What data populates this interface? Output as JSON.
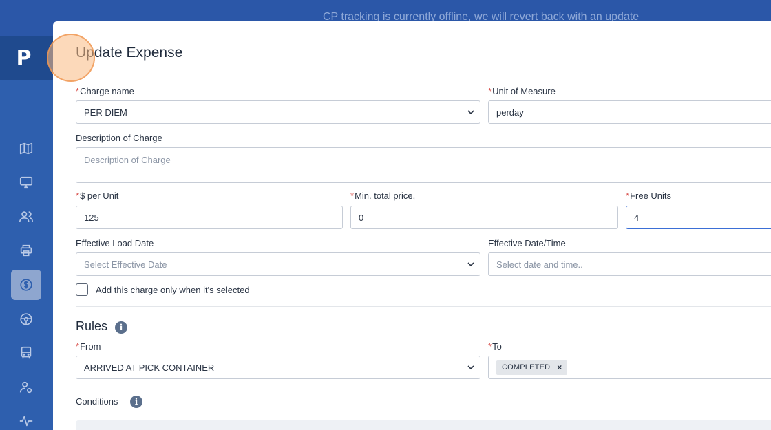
{
  "banner": {
    "text": "CP tracking is currently offline, we will revert back with an update"
  },
  "sidebar": {
    "logo": "P",
    "items": [
      {
        "icon": "map-icon"
      },
      {
        "icon": "monitor-icon"
      },
      {
        "icon": "users-icon"
      },
      {
        "icon": "printer-icon"
      },
      {
        "icon": "dollar-icon",
        "active": true
      },
      {
        "icon": "steering-wheel-icon"
      },
      {
        "icon": "bus-icon"
      },
      {
        "icon": "user-settings-icon"
      },
      {
        "icon": "activity-icon"
      }
    ]
  },
  "modal": {
    "title": "Update Expense",
    "charge_name": {
      "label": "Charge name",
      "value": "PER DIEM"
    },
    "unit_of_measure": {
      "label": "Unit of Measure",
      "value": "perday"
    },
    "description": {
      "label": "Description of Charge",
      "placeholder": "Description of Charge"
    },
    "per_unit": {
      "label": "$ per Unit",
      "value": "125"
    },
    "min_total": {
      "label": "Min. total price,",
      "value": "0"
    },
    "free_units": {
      "label": "Free Units",
      "value": "4"
    },
    "effective_load_date": {
      "label": "Effective Load Date",
      "placeholder": "Select Effective Date"
    },
    "effective_datetime": {
      "label": "Effective Date/Time",
      "placeholder": "Select date and time.."
    },
    "checkbox_label": "Add this charge only when it's selected",
    "rules": {
      "title": "Rules",
      "from": {
        "label": "From",
        "value": "ARRIVED AT PICK CONTAINER"
      },
      "to": {
        "label": "To",
        "chip": "COMPLETED"
      }
    },
    "conditions": {
      "label": "Conditions"
    },
    "required_marker": "*",
    "info_glyph": "i",
    "chip_remove": "×"
  },
  "colors": {
    "brand": "#2b57a8",
    "sidebar": "#2e5fae",
    "required": "#d9534f",
    "focus": "#3b6fd6"
  }
}
